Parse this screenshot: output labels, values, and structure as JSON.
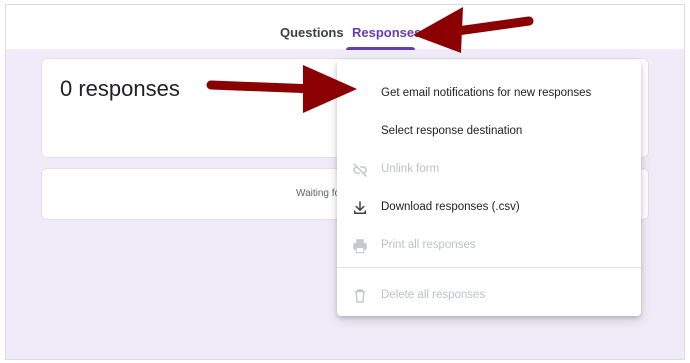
{
  "tabs": {
    "questions": "Questions",
    "responses": "Responses"
  },
  "summary": {
    "count_text": "0 responses"
  },
  "waiting": {
    "text": "Waiting fo"
  },
  "menu": {
    "items": [
      {
        "label": "Get email notifications for new responses",
        "enabled": true,
        "icon": "none"
      },
      {
        "label": "Select response destination",
        "enabled": true,
        "icon": "none"
      },
      {
        "label": "Unlink form",
        "enabled": false,
        "icon": "unlink-icon"
      },
      {
        "label": "Download responses (.csv)",
        "enabled": true,
        "icon": "download-icon"
      },
      {
        "label": "Print all responses",
        "enabled": false,
        "icon": "printer-icon"
      },
      {
        "label": "Delete all responses",
        "enabled": false,
        "icon": "trash-icon"
      }
    ]
  },
  "colors": {
    "accent": "#673ab7",
    "background": "#f0ebf8",
    "arrow": "#8b0000"
  }
}
